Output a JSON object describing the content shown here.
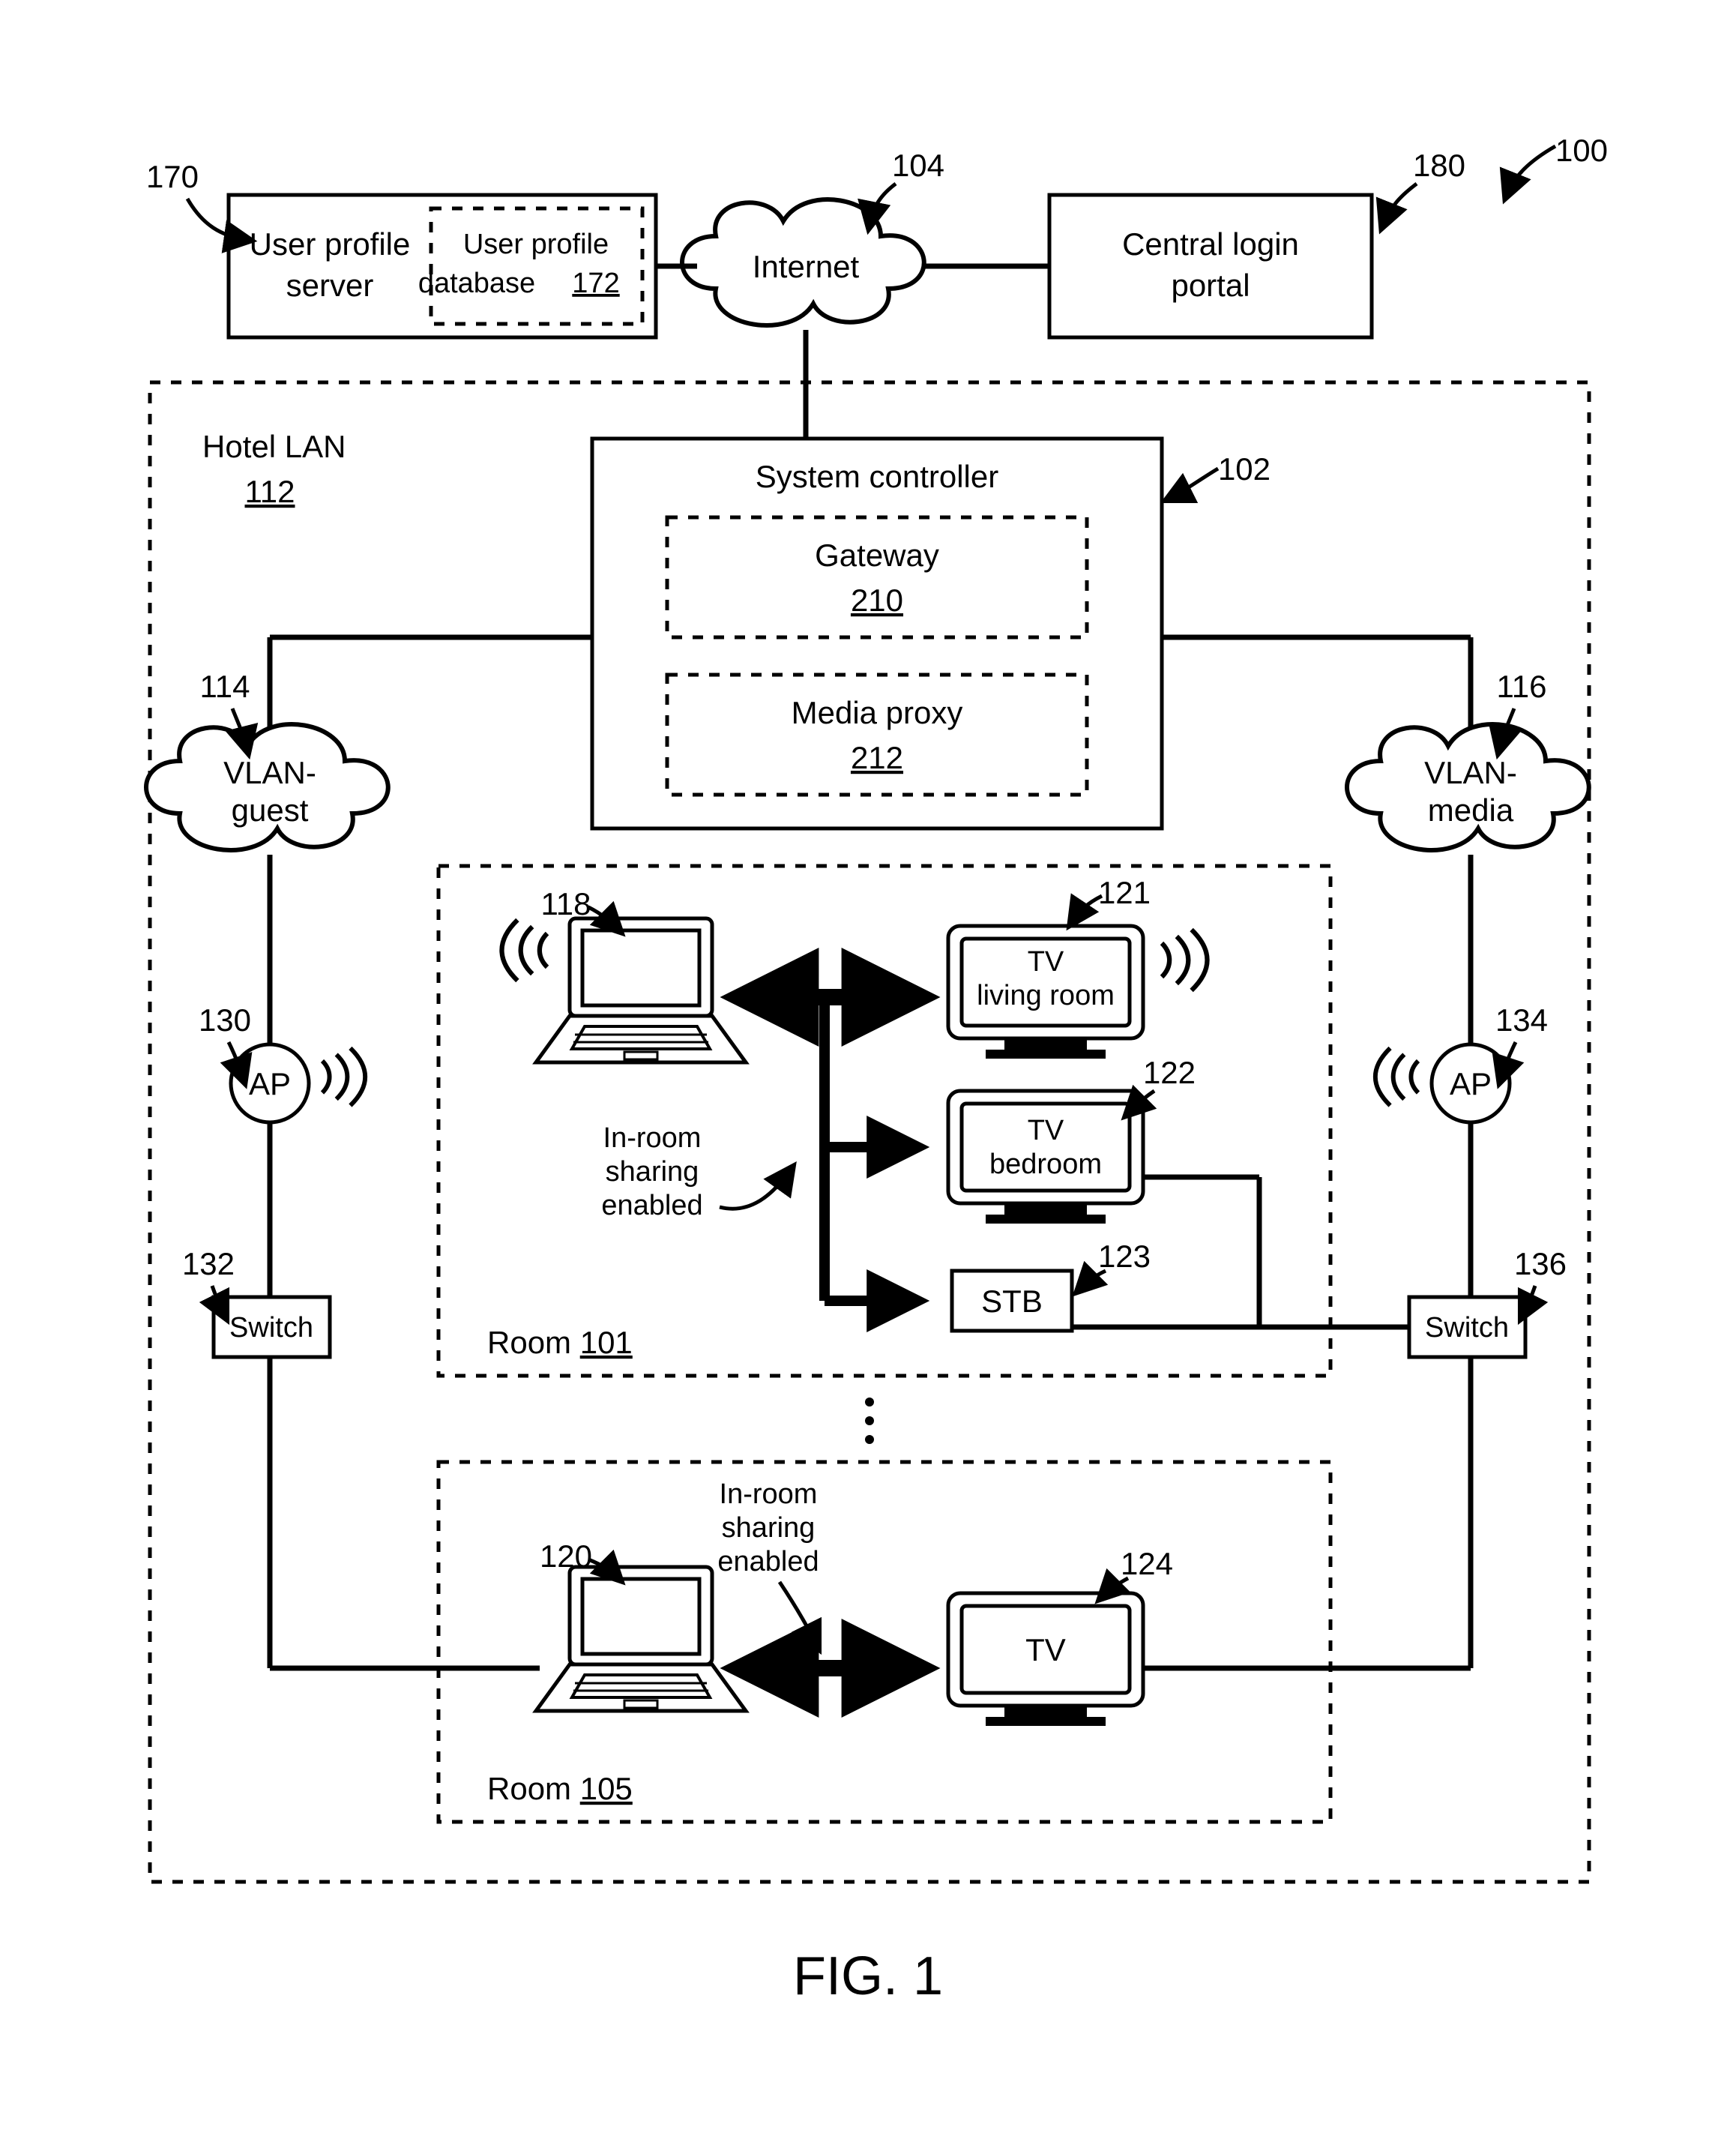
{
  "figure_label": "FIG. 1",
  "ref_100": "100",
  "ref_170": "170",
  "ref_172": "172",
  "ref_104": "104",
  "ref_180": "180",
  "ref_112": "112",
  "ref_102": "102",
  "ref_210": "210",
  "ref_212": "212",
  "ref_114": "114",
  "ref_116": "116",
  "ref_118": "118",
  "ref_120": "120",
  "ref_121": "121",
  "ref_122": "122",
  "ref_123": "123",
  "ref_124": "124",
  "ref_130": "130",
  "ref_132": "132",
  "ref_134": "134",
  "ref_136": "136",
  "ref_101": "101",
  "ref_105": "105",
  "user_profile_server_l1": "User profile",
  "user_profile_server_l2": "server",
  "user_profile_db_l1": "User profile",
  "user_profile_db_l2": "database",
  "internet": "Internet",
  "central_login_l1": "Central login",
  "central_login_l2": "portal",
  "hotel_lan": "Hotel LAN",
  "system_controller": "System controller",
  "gateway": "Gateway",
  "media_proxy": "Media proxy",
  "vlan_guest_l1": "VLAN-",
  "vlan_guest_l2": "guest",
  "vlan_media_l1": "VLAN-",
  "vlan_media_l2": "media",
  "ap": "AP",
  "switch": "Switch",
  "room": "Room",
  "inroom_l1": "In-room",
  "inroom_l2": "sharing",
  "inroom_l3": "enabled",
  "tv": "TV",
  "tv_living_l1": "TV",
  "tv_living_l2": "living room",
  "tv_bedroom_l1": "TV",
  "tv_bedroom_l2": "bedroom",
  "stb": "STB"
}
